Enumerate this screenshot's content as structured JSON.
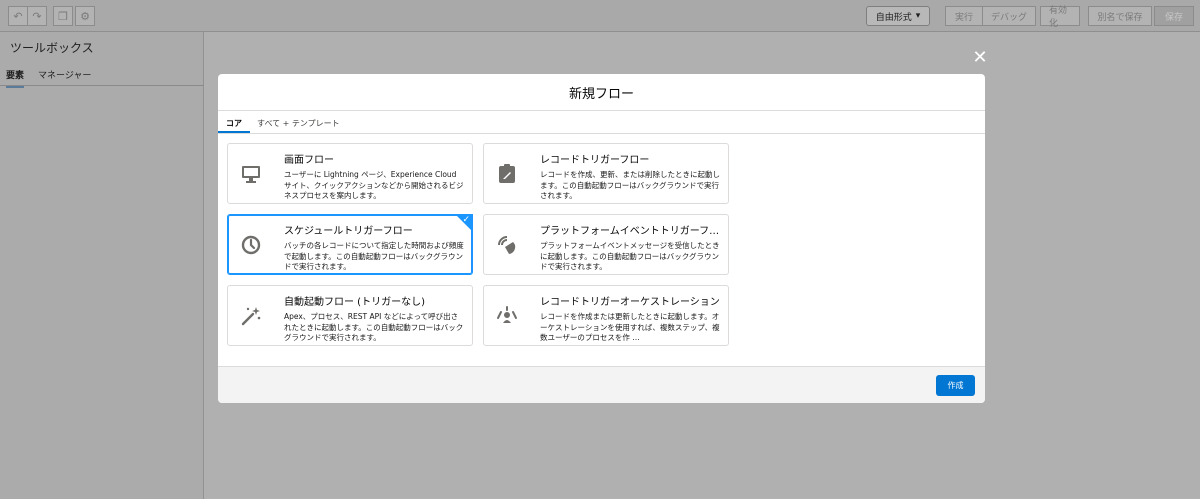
{
  "toolbar": {
    "undo_icon": "undo-icon",
    "redo_icon": "redo-icon",
    "copy_icon": "copy-icon",
    "settings_icon": "gear-icon",
    "mode_select": "自由形式",
    "buttons": [
      "実行",
      "デバッグ",
      "有効化",
      "別名で保存",
      "保存"
    ]
  },
  "sidebar": {
    "title": "ツールボックス",
    "tabs": [
      "要素",
      "マネージャー"
    ]
  },
  "modal": {
    "title": "新規フロー",
    "close": "✕",
    "tabs": [
      "コア",
      "すべて + テンプレート"
    ],
    "cards": [
      {
        "title": "画面フロー",
        "desc": "ユーザーに Lightning ページ、Experience Cloud サイト、クイックアクションなどから開始されるビジネスプロセスを案内します。",
        "icon": "monitor-icon"
      },
      {
        "title": "レコードトリガーフロー",
        "desc": "レコードを作成、更新、または削除したときに起動します。この自動起動フローはバックグラウンドで実行されます。",
        "icon": "clipboard-icon"
      },
      {
        "title": "スケジュールトリガーフロー",
        "desc": "バッチの各レコードについて指定した時間および頻度で起動します。この自動起動フローはバックグラウンドで実行されます。",
        "icon": "clock-icon"
      },
      {
        "title": "プラットフォームイベントトリガーフ…",
        "desc": "プラットフォームイベントメッセージを受信したときに起動します。この自動起動フローはバックグラウンドで実行されます。",
        "icon": "broadcast-icon"
      },
      {
        "title": "自動起動フロー (トリガーなし)",
        "desc": "Apex、プロセス、REST API などによって呼び出されたときに起動します。この自動起動フローはバックグラウンドで実行されます。",
        "icon": "magic-wand-icon"
      },
      {
        "title": "レコードトリガーオーケストレーション",
        "desc": "レコードを作成または更新したときに起動します。オーケストレーションを使用すれば、複数ステップ、複数ユーザーのプロセスを作 …",
        "icon": "orchestration-icon"
      }
    ],
    "create_label": "作成"
  },
  "colors": {
    "accent": "#0176d3",
    "selected": "#1b96ff"
  }
}
